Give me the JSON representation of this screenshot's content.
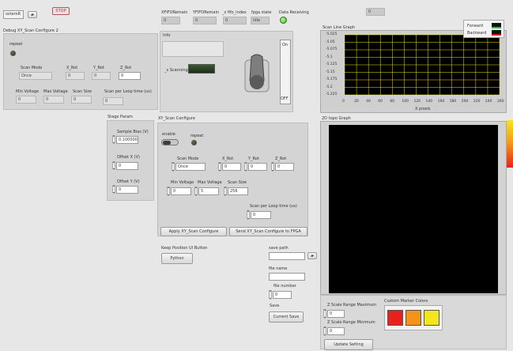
{
  "top": {
    "resource_value": "ostemR",
    "stop_label": "STOP",
    "xfifo_label": "XFIFORemain",
    "xfifo_value": "0",
    "yfifo_label": "YFIFORemain",
    "yfifo_value": "0",
    "zfifo_label": "_z fifo_index",
    "zfifo_value": "0",
    "fpga_state_label": "fpga state",
    "fpga_state_value": "idle",
    "data_receiving_label": "Data Receiving",
    "top_right_value": "0"
  },
  "debug_panel": {
    "title": "Debug XY_Scan Configure 2",
    "repeat_label": "repeat",
    "scan_mode_label": "Scan Mode",
    "scan_mode_value": "Once",
    "xrot_label": "X_Rot",
    "xrot_value": "0",
    "yrot_label": "Y_Rot",
    "yrot_value": "0",
    "zrot_label": "Z_Rot",
    "zrot_value": "0",
    "min_voltage_label": "Min Voltage",
    "min_voltage_value": "0",
    "max_voltage_label": "Max Voltage",
    "max_voltage_value": "0",
    "scan_size_label": "Scan Size",
    "scan_size_value": "0",
    "scan_per_loop_label": "Scan per Loop time (us)",
    "scan_per_loop_value": "0"
  },
  "info_panel": {
    "title": "Info",
    "scanning_label": "_s Scanning",
    "on_label": "On",
    "off_label": "OFF"
  },
  "line_graph": {
    "title": "Scan Line Graph",
    "legend": [
      {
        "name": "Forward",
        "color": "#00cc33"
      },
      {
        "name": "Backward",
        "color": "#cc2222"
      }
    ],
    "xlabel": "X pixels"
  },
  "chart_data": {
    "type": "line",
    "title": "Scan Line Graph",
    "xlabel": "X pixels",
    "ylabel": "",
    "xlim": [
      0,
      260
    ],
    "ylim": [
      -5.225,
      -5.025
    ],
    "x_ticks": [
      "0",
      "20",
      "40",
      "60",
      "80",
      "100",
      "120",
      "140",
      "160",
      "180",
      "200",
      "220",
      "240",
      "260"
    ],
    "y_ticks": [
      "-5.025",
      "-5.05",
      "-5.075",
      "-5.1",
      "-5.125",
      "-5.15",
      "-5.175",
      "-5.2",
      "-5.225"
    ],
    "grid": true,
    "legend_position": "top-right",
    "series": [
      {
        "name": "Forward",
        "values": []
      },
      {
        "name": "Backward",
        "values": []
      }
    ]
  },
  "stage_param": {
    "title": "Stage Param",
    "sample_bias_label": "Sample Bias (V)",
    "sample_bias_value": "0.100000",
    "offset_x_label": "Offset X (V)",
    "offset_x_value": "0",
    "offset_y_label": "Offset Y (V)",
    "offset_y_value": "0"
  },
  "xy_scan": {
    "title": "XY_Scan Configure",
    "enable_label": "enable",
    "repeat_label": "repeat",
    "scan_mode_label": "Scan Mode",
    "scan_mode_value": "Once",
    "xrot_label": "X_Rot",
    "xrot_value": "0",
    "yrot_label": "Y_Rot",
    "yrot_value": "0",
    "zrot_label": "Z_Rot",
    "zrot_value": "0",
    "min_voltage_label": "Min Voltage",
    "min_voltage_value": "0",
    "max_voltage_label": "Max Voltage",
    "max_voltage_value": "5",
    "scan_size_label": "Scan Size",
    "scan_size_value": "256",
    "scan_per_loop_label": "Scan per Loop time (us)",
    "scan_per_loop_value": "0",
    "apply_label": "Apply XY_Scan Configure",
    "send_label": "Send XY_Scan Configure to FPGA"
  },
  "keep_position": {
    "label": "Keep Position UI Button",
    "python_label": "Python"
  },
  "save": {
    "save_path_label": "save path",
    "save_path_value": "",
    "file_name_label": "file name",
    "file_number_label": "file number",
    "file_number_value": "0",
    "save_label": "Save",
    "current_save_label": "Current Save"
  },
  "graph_2d": {
    "title": "2D topo Graph"
  },
  "zscale": {
    "max_label": "Z Scale Range Maximum",
    "max_value": "0",
    "min_label": "Z Scale Range Minimum",
    "min_value": "0",
    "custom_colors_label": "Custom Marker Colors",
    "colors": [
      "#e8201e",
      "#f39418",
      "#f5e51d"
    ],
    "update_label": "Update Setting"
  }
}
